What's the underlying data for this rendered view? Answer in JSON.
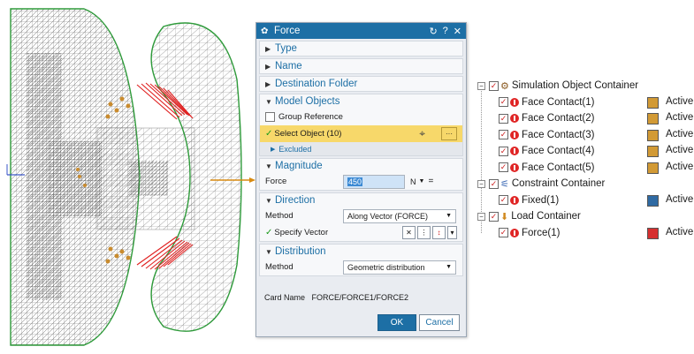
{
  "dialog": {
    "title": "Force",
    "sections": {
      "type": "Type",
      "name": "Name",
      "destination_folder": "Destination Folder",
      "model_objects": "Model Objects",
      "magnitude": "Magnitude",
      "direction": "Direction",
      "distribution": "Distribution"
    },
    "group_reference": "Group Reference",
    "select_object": "Select Object (10)",
    "excluded": "Excluded",
    "force_label": "Force",
    "force_value": "450",
    "force_unit": "N",
    "direction_method_label": "Method",
    "direction_method_value": "Along Vector (FORCE)",
    "specify_vector": "Specify Vector",
    "distribution_method_label": "Method",
    "distribution_method_value": "Geometric distribution",
    "card_name_label": "Card Name",
    "card_name_value": "FORCE/FORCE1/FORCE2",
    "ok": "OK",
    "cancel": "Cancel"
  },
  "tree": {
    "items": [
      {
        "label": "Simulation Object Container",
        "level": 0,
        "kind": "container",
        "icon": "simulation-object-icon"
      },
      {
        "label": "Face Contact(1)",
        "level": 1,
        "status": "Active",
        "color": "#d29a35"
      },
      {
        "label": "Face Contact(2)",
        "level": 1,
        "status": "Active",
        "color": "#d29a35"
      },
      {
        "label": "Face Contact(3)",
        "level": 1,
        "status": "Active",
        "color": "#d29a35"
      },
      {
        "label": "Face Contact(4)",
        "level": 1,
        "status": "Active",
        "color": "#d29a35"
      },
      {
        "label": "Face Contact(5)",
        "level": 1,
        "status": "Active",
        "color": "#d29a35"
      },
      {
        "label": "Constraint Container",
        "level": 0,
        "kind": "container",
        "icon": "constraint-icon"
      },
      {
        "label": "Fixed(1)",
        "level": 1,
        "status": "Active",
        "color": "#2f6aa3"
      },
      {
        "label": "Load Container",
        "level": 0,
        "kind": "container",
        "icon": "load-icon"
      },
      {
        "label": "Force(1)",
        "level": 1,
        "status": "Active",
        "color": "#d63030"
      }
    ]
  },
  "colors": {
    "accent": "#1d6fa5",
    "selection": "#f7d86a",
    "mesh_green": "#2e9a3a",
    "force_red": "#e02020",
    "connector": "#d88a10"
  }
}
